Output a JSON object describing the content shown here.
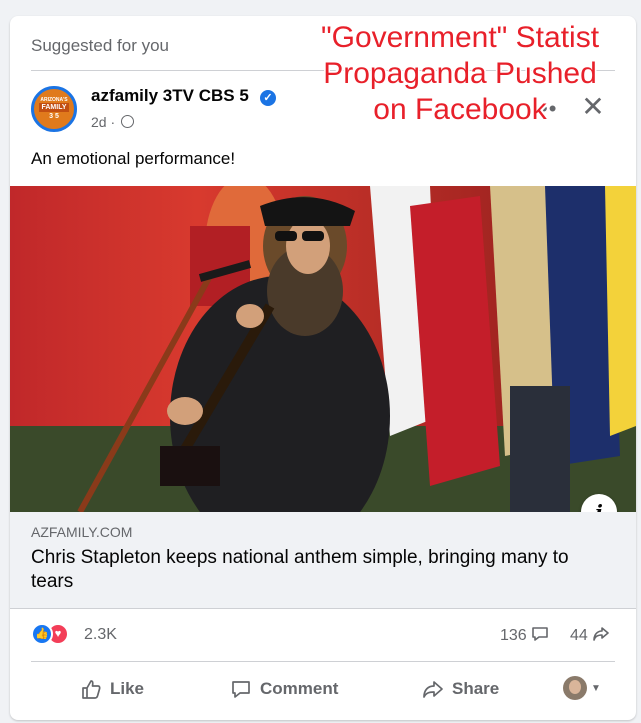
{
  "overlay_caption": "\"Government\" Statist\nPropaganda Pushed\non Facebook",
  "post": {
    "suggested_label": "Suggested for you",
    "page_name": "azfamily 3TV CBS 5",
    "age": "2d",
    "meta_separator": "·",
    "text": "An emotional performance!",
    "avatar": {
      "arc": "ARIZONA'S",
      "mid": "FAMILY",
      "nums": "3 5"
    }
  },
  "link_preview": {
    "domain": "AZFAMILY.COM",
    "headline": "Chris Stapleton keeps national anthem simple, bringing many to tears",
    "info_glyph": "i"
  },
  "stats": {
    "reactions_count": "2.3K",
    "comments_count": "136",
    "shares_count": "44"
  },
  "actions": {
    "like": "Like",
    "comment": "Comment",
    "share": "Share"
  },
  "icons": {
    "verified": "verified-badge-icon",
    "globe": "globe-icon",
    "close": "close-icon",
    "more": "more-options-icon"
  },
  "colors": {
    "accent": "#1877f2",
    "overlay_text": "#e8202a",
    "love": "#f33e58"
  }
}
